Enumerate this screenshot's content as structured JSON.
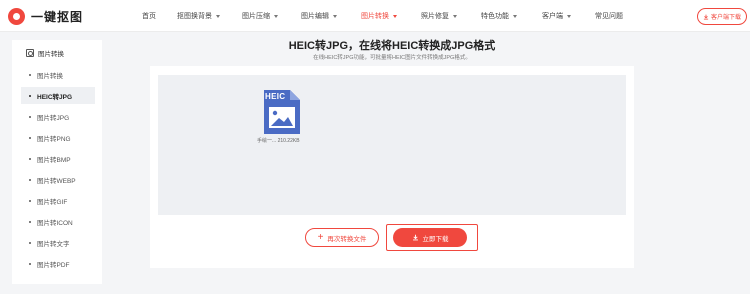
{
  "brand": {
    "name": "一键抠图"
  },
  "nav": {
    "items": [
      {
        "label": "首页",
        "has_dropdown": false,
        "active": false
      },
      {
        "label": "抠图换背景",
        "has_dropdown": true,
        "active": false
      },
      {
        "label": "图片压缩",
        "has_dropdown": true,
        "active": false
      },
      {
        "label": "图片编辑",
        "has_dropdown": true,
        "active": false
      },
      {
        "label": "图片转换",
        "has_dropdown": true,
        "active": true
      },
      {
        "label": "照片修复",
        "has_dropdown": true,
        "active": false
      },
      {
        "label": "特色功能",
        "has_dropdown": true,
        "active": false
      },
      {
        "label": "客户端",
        "has_dropdown": true,
        "active": false
      },
      {
        "label": "常见问题",
        "has_dropdown": false,
        "active": false
      }
    ],
    "client_button": "客户端下载"
  },
  "sidebar": {
    "title": "图片转换",
    "items": [
      {
        "label": "图片转换",
        "active": false
      },
      {
        "label": "HEIC转JPG",
        "active": true
      },
      {
        "label": "图片转JPG",
        "active": false
      },
      {
        "label": "图片转PNG",
        "active": false
      },
      {
        "label": "图片转BMP",
        "active": false
      },
      {
        "label": "图片转WEBP",
        "active": false
      },
      {
        "label": "图片转GIF",
        "active": false
      },
      {
        "label": "图片转ICON",
        "active": false
      },
      {
        "label": "图片转文字",
        "active": false
      },
      {
        "label": "图片转PDF",
        "active": false
      }
    ]
  },
  "main": {
    "title": "HEIC转JPG，在线将HEIC转换成JPG格式",
    "subtitle": "在线HEIC转JPG功能，可批量将HEIC图片文件转换成JPG格式。",
    "file": {
      "badge": "HEIC",
      "name": "手绘一...",
      "size": "210.22KB"
    },
    "convert_again_label": "再次转换文件",
    "download_label": "立即下载"
  },
  "colors": {
    "accent": "#f0483e",
    "panel_bg": "#eef0f3",
    "file_icon": "#4a6bc4"
  }
}
